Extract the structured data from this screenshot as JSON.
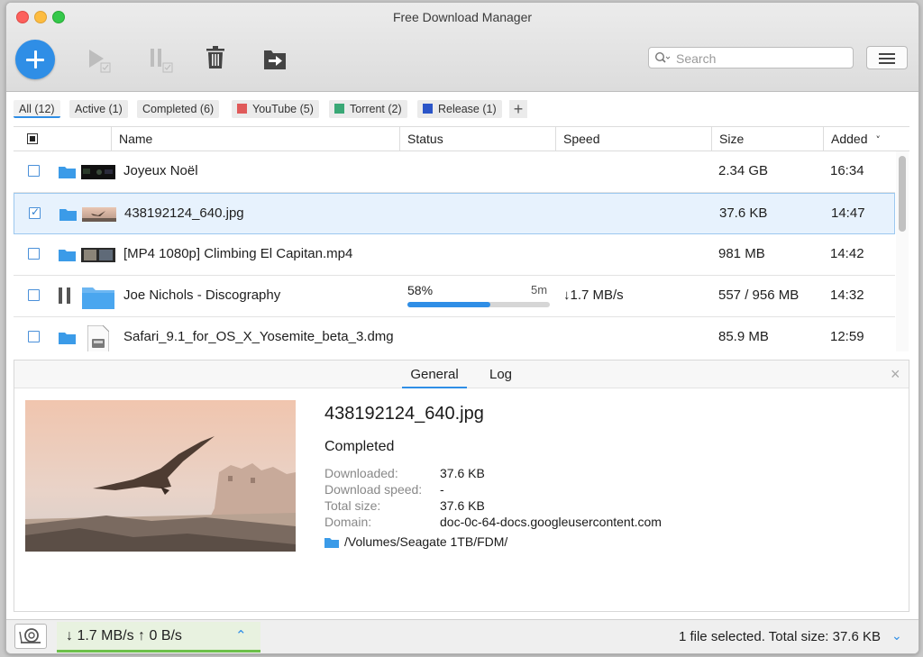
{
  "window": {
    "title": "Free Download Manager"
  },
  "toolbar": {
    "add_icon": "plus-icon",
    "start_icon": "play-icon",
    "pause_icon": "pause-icon",
    "delete_icon": "trash-icon",
    "move_icon": "move-to-folder-icon",
    "menu_icon": "hamburger-menu-icon"
  },
  "search": {
    "placeholder": "Search",
    "value": ""
  },
  "filters": [
    {
      "label": "All (12)",
      "active": true
    },
    {
      "label": "Active (1)"
    },
    {
      "label": "Completed (6)"
    },
    {
      "label": "YouTube (5)",
      "color": "#e05a5a"
    },
    {
      "label": "Torrent (2)",
      "color": "#3aa876"
    },
    {
      "label": "Release (1)",
      "color": "#2b55c8"
    }
  ],
  "table": {
    "columns": [
      "Name",
      "Status",
      "Speed",
      "Size",
      "Added"
    ],
    "sort_indicator": "˅",
    "rows": [
      {
        "name": "Joyeux Noël",
        "status": "",
        "speed": "",
        "size": "2.34 GB",
        "added": "16:34",
        "checked": false
      },
      {
        "name": "438192124_640.jpg",
        "status": "",
        "speed": "",
        "size": "37.6 KB",
        "added": "14:47",
        "checked": true,
        "selected": true
      },
      {
        "name": "[MP4 1080p] Climbing El Capitan.mp4",
        "status": "",
        "speed": "",
        "size": "981 MB",
        "added": "14:42",
        "checked": false
      },
      {
        "name": "Joe Nichols - Discography",
        "status": "58%",
        "eta": "5m",
        "progress": 0.58,
        "speed": "↓1.7 MB/s",
        "size": "557 / 956 MB",
        "added": "14:32",
        "checked": false
      },
      {
        "name": "Safari_9.1_for_OS_X_Yosemite_beta_3.dmg",
        "status": "",
        "speed": "",
        "size": "85.9 MB",
        "added": "12:59",
        "checked": false
      }
    ]
  },
  "details": {
    "tabs": [
      "General",
      "Log"
    ],
    "close": "×",
    "title": "438192124_640.jpg",
    "status": "Completed",
    "fields": [
      {
        "k": "Downloaded:",
        "v": "37.6 KB"
      },
      {
        "k": "Download speed:",
        "v": "-"
      },
      {
        "k": "Total size:",
        "v": "37.6 KB"
      },
      {
        "k": "Domain:",
        "v": "doc-0c-64-docs.googleusercontent.com"
      }
    ],
    "path": "/Volumes/Seagate 1TB/FDM/"
  },
  "statusbar": {
    "speed": "↓ 1.7 MB/s ↑ 0 B/s",
    "speed_chevron": "⌃",
    "text": "1 file selected. Total size: 37.6 KB",
    "chevron": "⌄"
  },
  "colors": {
    "accent": "#2f8ee6",
    "green": "#6cc04a",
    "selected_row": "#e7f2fd"
  }
}
